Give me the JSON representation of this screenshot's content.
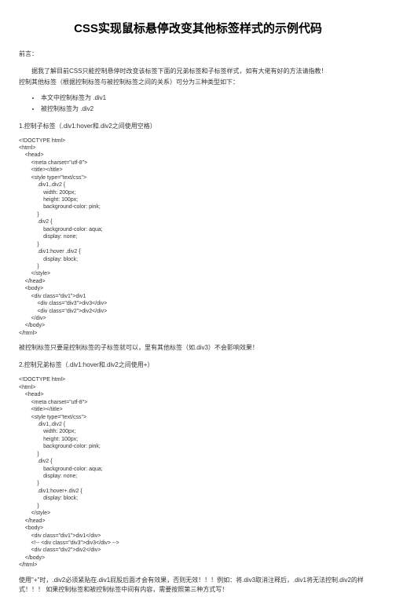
{
  "title": "CSS实现鼠标悬停改变其他标签样式的示例代码",
  "preface_label": "前言：",
  "preface_p1": "据我了解目前CSS只能控制悬停时改变该标签下面的兄弟标签和子标签样式，如有大佬有好的方法请指教！",
  "preface_p2": "控制其他标签（根据控制标签与被控制标签之间的关系）可分为三种类型如下：",
  "bullets": [
    "本文中控制标签为 .div1",
    "被控制标签为 .div2"
  ],
  "section1_h": "1.控制子标签（.div1:hover和.div2之间使用空格）",
  "code1": "<!DOCTYPE html>\n<html>\n    <head>\n        <meta charset=\"utf-8\">\n        <title></title>\n        <style type=\"text/css\">\n            .div1,.div2 {\n                width: 200px;\n                height: 100px;\n                background-color: pink;\n            }\n            .div2 {\n                background-color: aqua;\n                display: none;\n            }\n            .div1:hover .div2 {\n                display: block;\n            }\n        </style>\n    </head>\n    <body>\n        <div class=\"div1\">div1\n            <div class=\"div3\">div3</div>\n            <div class=\"div2\">div2</div>\n        </div>\n    </body>\n</html>",
  "note1": "被控制标签只要是控制标签的子标签就可以，里有其他标签（如.div3）不会影响效果！",
  "section2_h": "2.控制兄弟标签（.div1:hover和.div2之间使用+）",
  "code2": "<!DOCTYPE html>\n<html>\n    <head>\n        <meta charset=\"utf-8\">\n        <title></title>\n        <style type=\"text/css\">\n            .div1,.div2 {\n                width: 200px;\n                height: 100px;\n                background-color: pink;\n            }\n            .div2 {\n                background-color: aqua;\n                display: none;\n            }\n            .div1:hover+.div2 {\n                display: block;\n            }\n        </style>\n    </head>\n    <body>\n        <div class=\"div1\">div1</div>\n        <!-- <div class=\"div3\">div3</div> -->\n        <div class=\"div2\">div2</div>\n    </body>\n</html>",
  "note2": "使用\"+\"时，.div2必须紧贴在.div1屁股后面才会有效果，否则无效！！！例如：将.div3取消注释后，.div1将无法控制.div2的样式！！！ 如果控制标签和被控制标签中间有内容，需要按照第三种方式写！"
}
